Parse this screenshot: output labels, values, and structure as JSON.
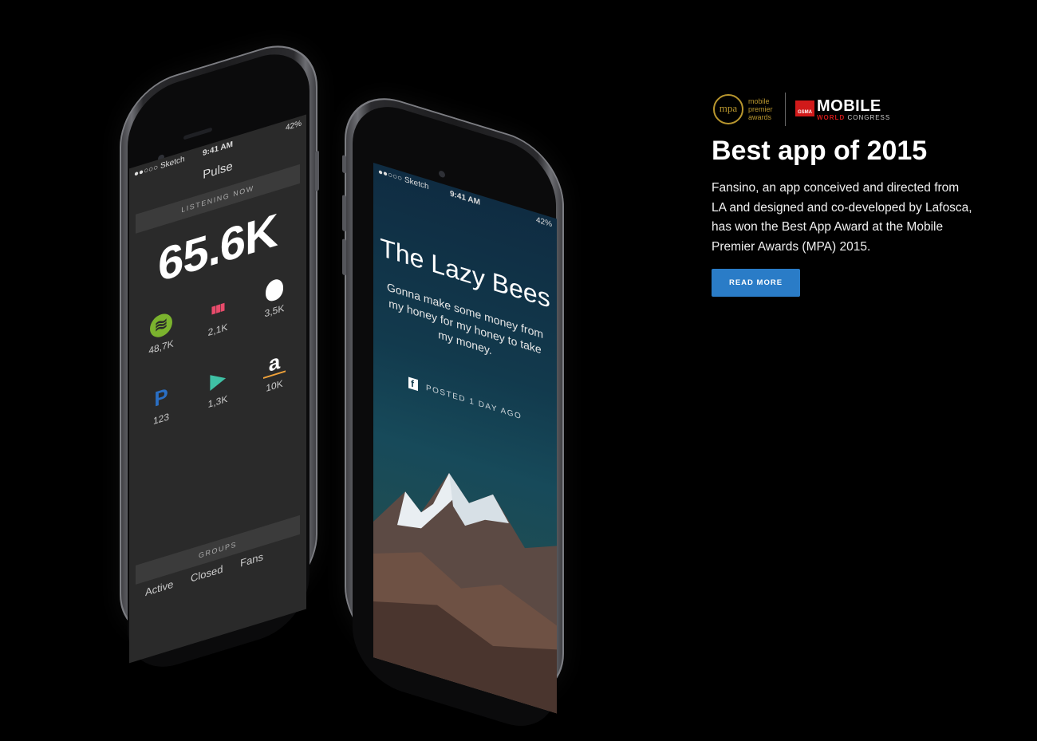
{
  "colors": {
    "accent": "#2a7cc7",
    "gold": "#b8962e",
    "gsma_red": "#d11a1a",
    "background": "#000000"
  },
  "awards": {
    "mpa_logo": "mpa",
    "mpa_text_1": "mobile",
    "mpa_text_2": "premier",
    "mpa_text_3": "awards",
    "gsma": "GSMA",
    "mwc_main": "MOBILE",
    "mwc_sub_red": "WORLD",
    "mwc_sub_rest": " CONGRESS"
  },
  "headline": "Best app of 2015",
  "blurb": "Fansino, an app conceived and directed from LA and designed and co-developed by Lafosca, has won the Best App Award at the Mobile Premier Awards (MPA) 2015.",
  "read_more_label": "READ MORE",
  "left_phone": {
    "carrier": "●●○○○ Sketch",
    "time": "9:41 AM",
    "battery": "42%",
    "app_title": "Pulse",
    "listening_label": "LISTENING NOW",
    "big_number": "65.6K",
    "services": [
      {
        "icon": "spotify-icon",
        "glyph": "≋",
        "value": "48,7K"
      },
      {
        "icon": "deezer-icon",
        "glyph": "▮▮▮",
        "value": "2,1K"
      },
      {
        "icon": "apple-icon",
        "glyph": "",
        "value": "3,5K"
      },
      {
        "icon": "pandora-icon",
        "glyph": "P",
        "value": "123"
      },
      {
        "icon": "google-play-icon",
        "glyph": "▶",
        "value": "1,3K"
      },
      {
        "icon": "amazon-icon",
        "glyph": "a",
        "value": "10K"
      }
    ],
    "groups_label": "GROUPS",
    "tabs": [
      "Active",
      "Closed",
      "Fans"
    ]
  },
  "right_phone": {
    "carrier": "●●○○○ Sketch",
    "time": "9:41 AM",
    "battery": "42%",
    "song_title": "The Lazy Bees",
    "song_text": "Gonna make some money from my honey for my honey to take my money.",
    "posted": "POSTED 1 DAY AGO",
    "facebook_glyph": "f"
  }
}
